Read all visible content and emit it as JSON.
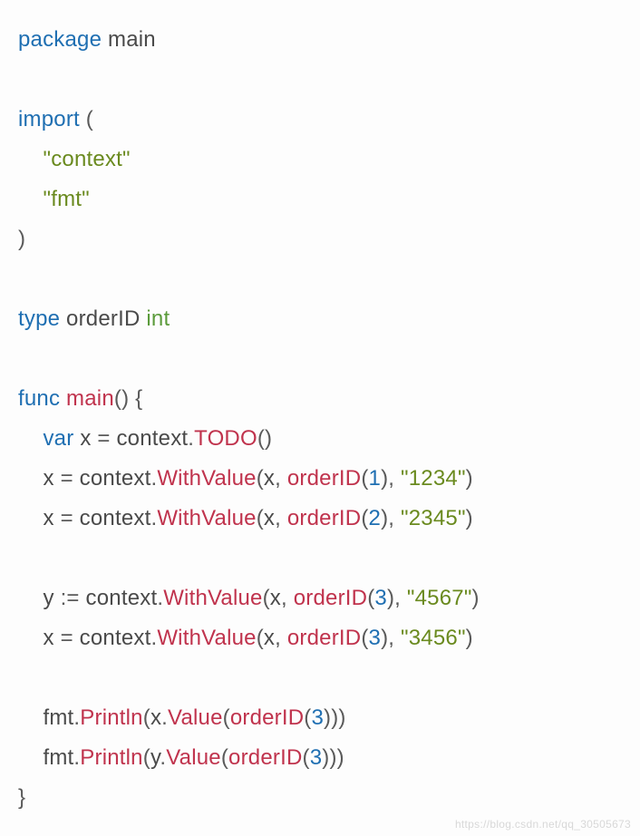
{
  "src": {
    "package_kw": "package",
    "package_name": "main",
    "import_kw": "import",
    "imp1": "\"context\"",
    "imp2": "\"fmt\"",
    "type_kw": "type",
    "type_name": "orderID",
    "type_base": "int",
    "func_kw": "func",
    "func_name": "main",
    "var_kw": "var",
    "var_x": "x",
    "eq": "=",
    "coloneq": ":=",
    "ctx": "context",
    "todo": "TODO",
    "withvalue": "WithValue",
    "orderid": "orderID",
    "n1": "1",
    "n2": "2",
    "n3": "3",
    "s1234": "\"1234\"",
    "s2345": "\"2345\"",
    "s4567": "\"4567\"",
    "s3456": "\"3456\"",
    "y": "y",
    "fmt": "fmt",
    "println": "Println",
    "value": "Value"
  },
  "watermark": "https://blog.csdn.net/qq_30505673"
}
